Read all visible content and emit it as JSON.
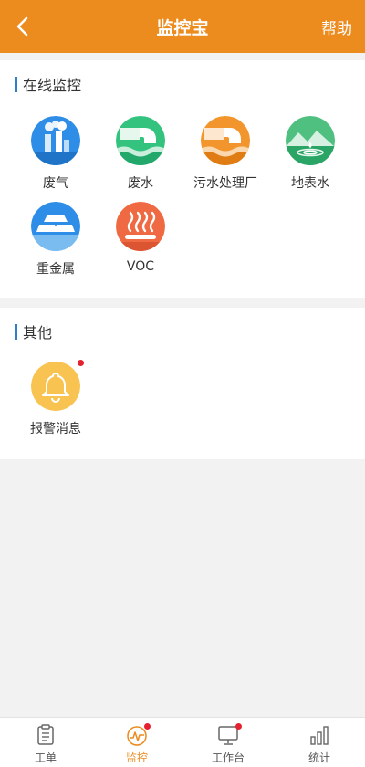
{
  "header": {
    "title": "监控宝",
    "help_label": "帮助",
    "back_icon": "chevron-left-icon"
  },
  "sections": {
    "online": {
      "title": "在线监控",
      "items": [
        {
          "label": "废气",
          "icon": "waste-gas-icon",
          "color": "#2e8de6"
        },
        {
          "label": "废水",
          "icon": "waste-water-icon",
          "color": "#33c37f"
        },
        {
          "label": "污水处理厂",
          "icon": "sewage-plant-icon",
          "color": "#f2952c"
        },
        {
          "label": "地表水",
          "icon": "surface-water-icon",
          "color": "#4fc07f"
        },
        {
          "label": "重金属",
          "icon": "heavy-metal-icon",
          "color": "#2e8de6"
        },
        {
          "label": "VOC",
          "icon": "voc-icon",
          "color": "#ef6a43"
        }
      ]
    },
    "other": {
      "title": "其他",
      "items": [
        {
          "label": "报警消息",
          "icon": "bell-icon",
          "color": "#f8c351"
        }
      ]
    }
  },
  "tabbar": {
    "active_color": "#ec8b1e",
    "tabs": [
      {
        "label": "工单",
        "icon": "clipboard-icon"
      },
      {
        "label": "监控",
        "icon": "monitor-gauge-icon",
        "active": true
      },
      {
        "label": "工作台",
        "icon": "desktop-icon"
      },
      {
        "label": "统计",
        "icon": "bar-chart-icon"
      }
    ]
  }
}
